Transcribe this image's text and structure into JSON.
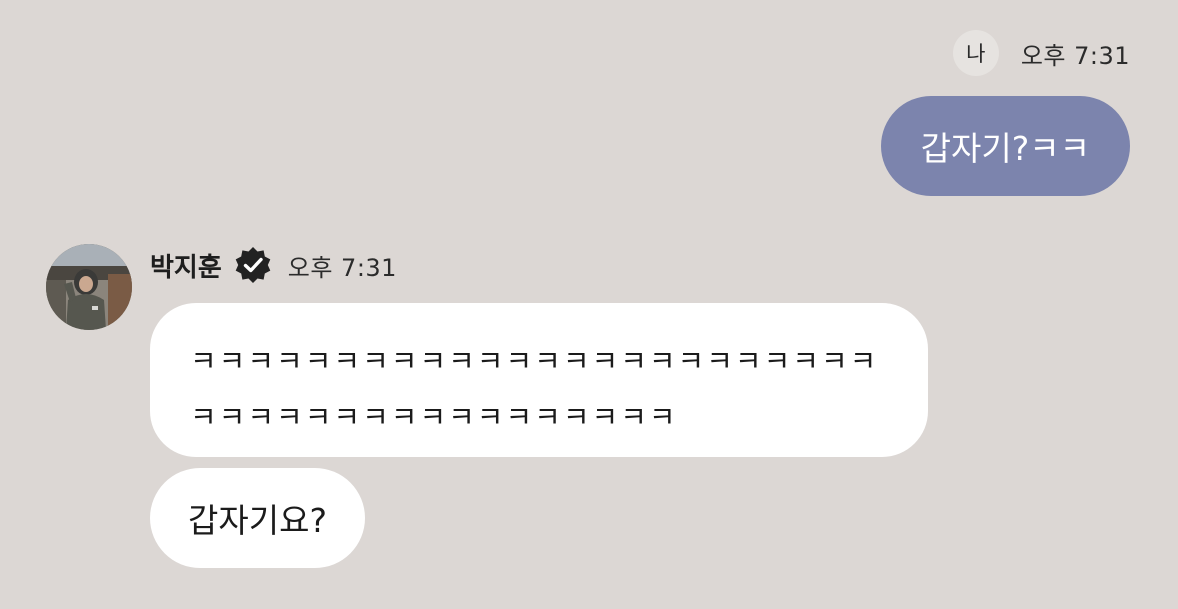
{
  "me": {
    "avatar_label": "나",
    "time": "오후 7:31",
    "message": "갑자기?ㅋㅋ"
  },
  "sender": {
    "name": "박지훈",
    "time": "오후 7:31",
    "messages": [
      "ㅋㅋㅋㅋㅋㅋㅋㅋㅋㅋㅋㅋㅋㅋㅋㅋㅋㅋㅋㅋㅋㅋㅋㅋㅋㅋㅋㅋㅋㅋㅋㅋㅋㅋㅋㅋㅋㅋㅋㅋㅋ",
      "갑자기요?"
    ]
  },
  "colors": {
    "background": "#dcd7d4",
    "outgoing_bubble": "#7c84ad",
    "incoming_bubble": "#ffffff"
  },
  "icons": {
    "verified": "verified-badge-icon"
  }
}
